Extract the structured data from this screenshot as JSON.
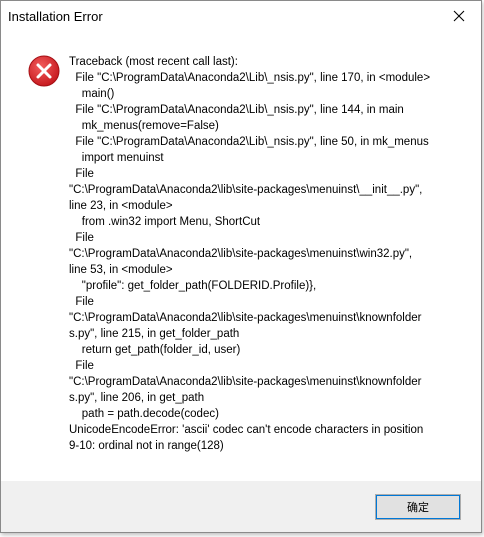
{
  "window": {
    "title": "Installation Error"
  },
  "icons": {
    "error": "error-icon",
    "close": "close-icon"
  },
  "colors": {
    "error_red": "#d9282f",
    "focus_blue": "#0078d7"
  },
  "message": "Traceback (most recent call last):\n  File \"C:\\ProgramData\\Anaconda2\\Lib\\_nsis.py\", line 170, in <module>\n    main()\n  File \"C:\\ProgramData\\Anaconda2\\Lib\\_nsis.py\", line 144, in main\n    mk_menus(remove=False)\n  File \"C:\\ProgramData\\Anaconda2\\Lib\\_nsis.py\", line 50, in mk_menus\n    import menuinst\n  File\n\"C:\\ProgramData\\Anaconda2\\lib\\site-packages\\menuinst\\__init__.py\",\nline 23, in <module>\n    from .win32 import Menu, ShortCut\n  File\n\"C:\\ProgramData\\Anaconda2\\lib\\site-packages\\menuinst\\win32.py\",\nline 53, in <module>\n    \"profile\": get_folder_path(FOLDERID.Profile)},\n  File\n\"C:\\ProgramData\\Anaconda2\\lib\\site-packages\\menuinst\\knownfolder\ns.py\", line 215, in get_folder_path\n    return get_path(folder_id, user)\n  File\n\"C:\\ProgramData\\Anaconda2\\lib\\site-packages\\menuinst\\knownfolder\ns.py\", line 206, in get_path\n    path = path.decode(codec)\nUnicodeEncodeError: 'ascii' codec can't encode characters in position\n9-10: ordinal not in range(128)",
  "buttons": {
    "ok_label": "确定"
  }
}
